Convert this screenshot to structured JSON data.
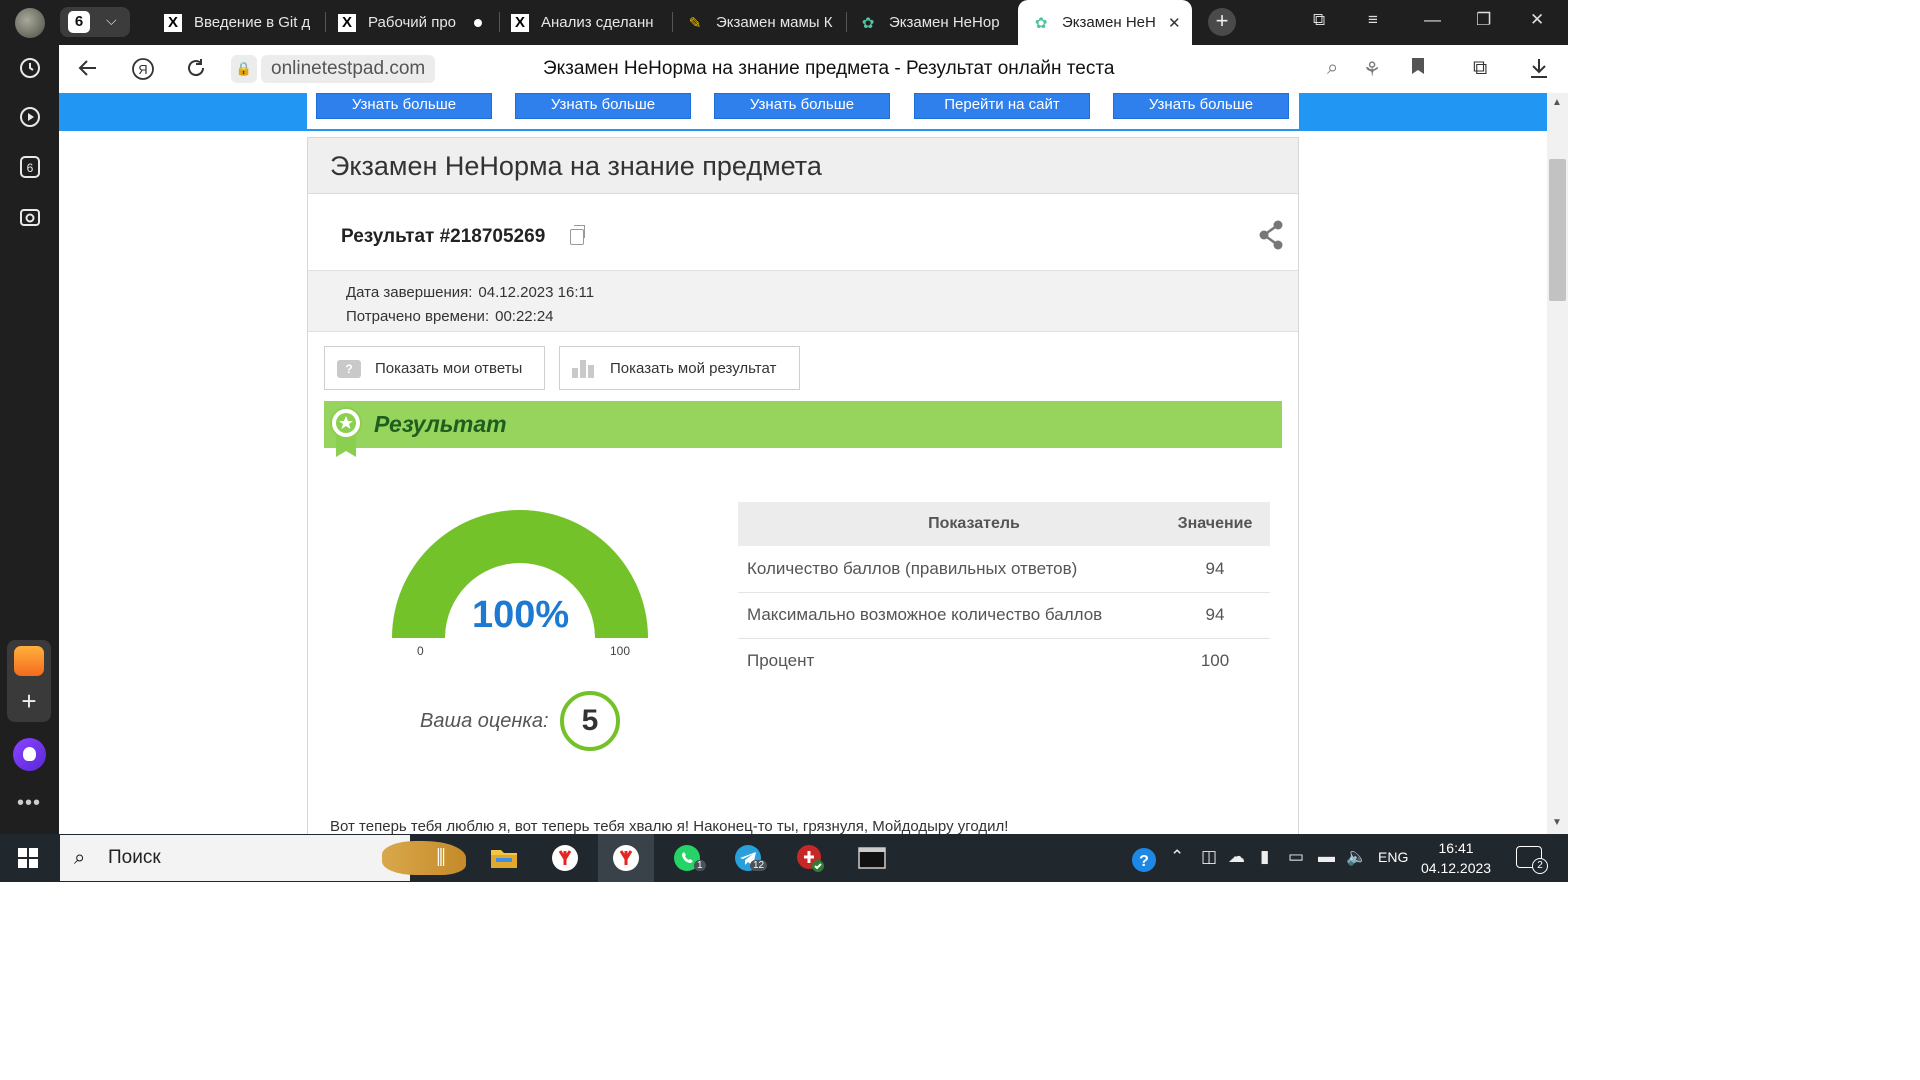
{
  "browser": {
    "tab_count": "6",
    "tabs": [
      {
        "label": "Введение в Git д",
        "icon": "x-icon"
      },
      {
        "label": "Рабочий про",
        "icon": "x-icon"
      },
      {
        "label": "Анализ сделанн",
        "icon": "x-icon"
      },
      {
        "label": "Экзамен мамы К",
        "icon": "puzzle-icon"
      },
      {
        "label": "Экзамен НеНор",
        "icon": "otp-icon"
      },
      {
        "label": "Экзамен НеН",
        "icon": "otp-icon"
      }
    ],
    "url_domain": "onlinetestpad.com",
    "page_title": "Экзамен НеНорма на знание предмета - Результат онлайн теста"
  },
  "ads": {
    "buttons": [
      "Узнать больше",
      "Узнать больше",
      "Узнать больше",
      "Перейти на сайт",
      "Узнать больше"
    ]
  },
  "test": {
    "title": "Экзамен НеНорма на знание предмета",
    "result_label": "Результат #218705269",
    "completed_label": "Дата завершения:",
    "completed_value": "04.12.2023 16:11",
    "spent_label": "Потрачено времени:",
    "spent_value": "00:22:24",
    "show_answers": "Показать мои ответы",
    "show_result": "Показать мой результат",
    "section_title": "Результат",
    "gauge": {
      "percent_text": "100%",
      "min": "0",
      "max": "100",
      "fraction": 1.0
    },
    "grade_label": "Ваша оценка:",
    "grade_value": "5",
    "table": {
      "headers": [
        "Показатель",
        "Значение"
      ],
      "rows": [
        [
          "Количество баллов (правильных ответов)",
          "94"
        ],
        [
          "Максимально возможное количество баллов",
          "94"
        ],
        [
          "Процент",
          "100"
        ]
      ]
    },
    "final_text": "Вот теперь тебя люблю я, вот теперь тебя хвалю я! Наконец-то ты, грязнуля, Мойдодыру угодил!"
  },
  "colors": {
    "accent_blue": "#2196f3",
    "result_green": "#97d45e",
    "gauge_green": "#74c22a",
    "percent_blue": "#1e7ad1"
  },
  "taskbar": {
    "search_label": "Поиск",
    "lang": "ENG",
    "time": "16:41",
    "date": "04.12.2023",
    "whatsapp_badge": "1",
    "telegram_badge": "12",
    "notif_count": "2"
  }
}
